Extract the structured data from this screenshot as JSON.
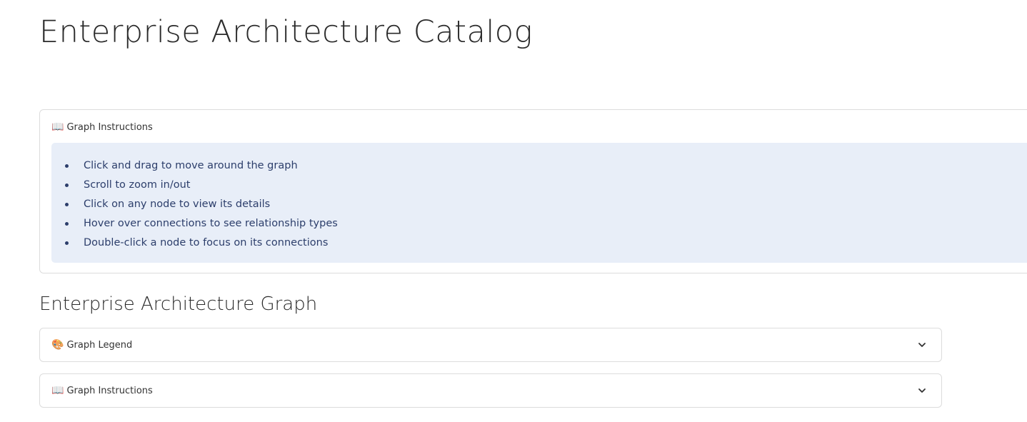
{
  "page": {
    "title": "Enterprise Architecture Catalog"
  },
  "instructions_panel": {
    "icon": "book-icon",
    "icon_glyph": "📖",
    "header": "Graph Instructions",
    "background_color": "#e8eef8",
    "text_color": "#2c3e6b",
    "items": [
      "Click and drag to move around the graph",
      "Scroll to zoom in/out",
      "Click on any node to view its details",
      "Hover over connections to see relationship types",
      "Double-click a node to focus on its connections"
    ]
  },
  "graph_section": {
    "title": "Enterprise Architecture Graph",
    "legend_panel": {
      "icon": "palette-icon",
      "icon_glyph": "🎨",
      "label": "Graph Legend",
      "expanded": false
    },
    "instructions_panel": {
      "icon": "book-icon",
      "icon_glyph": "📖",
      "label": "Graph Instructions",
      "expanded": false
    }
  }
}
